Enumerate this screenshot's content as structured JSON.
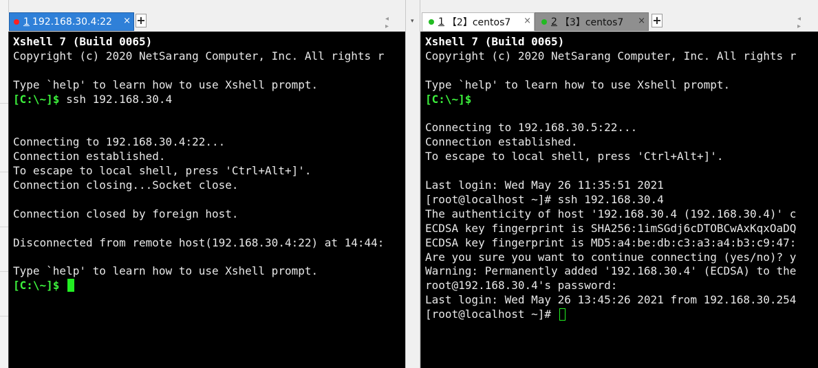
{
  "left_pane": {
    "tabs": [
      {
        "num": "1",
        "label": "192.168.30.4:22",
        "status_color": "#ff2020",
        "active": true,
        "close": "×"
      }
    ],
    "add_label": "+",
    "nav": "◂ ▸",
    "dropdown": "▾",
    "lines": [
      {
        "text": "Xshell 7 (Build 0065)",
        "style": "bold"
      },
      {
        "text": "Copyright (c) 2020 NetSarang Computer, Inc. All rights r"
      },
      {
        "text": ""
      },
      {
        "text": "Type `help' to learn how to use Xshell prompt."
      },
      {
        "prompt": "[C:\\~]$",
        "text": " ssh 192.168.30.4"
      },
      {
        "text": ""
      },
      {
        "text": ""
      },
      {
        "text": "Connecting to 192.168.30.4:22..."
      },
      {
        "text": "Connection established."
      },
      {
        "text": "To escape to local shell, press 'Ctrl+Alt+]'."
      },
      {
        "text": "Connection closing...Socket close."
      },
      {
        "text": ""
      },
      {
        "text": "Connection closed by foreign host."
      },
      {
        "text": ""
      },
      {
        "text": "Disconnected from remote host(192.168.30.4:22) at 14:44:"
      },
      {
        "text": ""
      },
      {
        "text": "Type `help' to learn how to use Xshell prompt."
      },
      {
        "prompt": "[C:\\~]$",
        "text": " ",
        "cursor": "solid"
      }
    ]
  },
  "right_pane": {
    "tabs": [
      {
        "num": "1",
        "label": "【2】centos7",
        "status_color": "#22bb22",
        "active": true,
        "close": "×"
      },
      {
        "num": "2",
        "label": "【3】centos7",
        "status_color": "#22bb22",
        "active": false,
        "close": "×"
      }
    ],
    "add_label": "+",
    "nav": "◂ ▸",
    "lines": [
      {
        "text": "Xshell 7 (Build 0065)",
        "style": "bold"
      },
      {
        "text": "Copyright (c) 2020 NetSarang Computer, Inc. All rights r"
      },
      {
        "text": ""
      },
      {
        "text": "Type `help' to learn how to use Xshell prompt."
      },
      {
        "prompt": "[C:\\~]$",
        "text": ""
      },
      {
        "text": ""
      },
      {
        "text": "Connecting to 192.168.30.5:22..."
      },
      {
        "text": "Connection established."
      },
      {
        "text": "To escape to local shell, press 'Ctrl+Alt+]'."
      },
      {
        "text": ""
      },
      {
        "text": "Last login: Wed May 26 11:35:51 2021"
      },
      {
        "text": "[root@localhost ~]# ssh 192.168.30.4"
      },
      {
        "text": "The authenticity of host '192.168.30.4 (192.168.30.4)' c"
      },
      {
        "text": "ECDSA key fingerprint is SHA256:1imSGdj6cDTOBCwAxKqxOaDQ"
      },
      {
        "text": "ECDSA key fingerprint is MD5:a4:be:db:c3:a3:a4:b3:c9:47:"
      },
      {
        "text": "Are you sure you want to continue connecting (yes/no)? y"
      },
      {
        "text": "Warning: Permanently added '192.168.30.4' (ECDSA) to the"
      },
      {
        "text": "root@192.168.30.4's password:"
      },
      {
        "text": "Last login: Wed May 26 13:45:26 2021 from 192.168.30.254"
      },
      {
        "text": "[root@localhost ~]# ",
        "cursor": "outline"
      }
    ]
  }
}
